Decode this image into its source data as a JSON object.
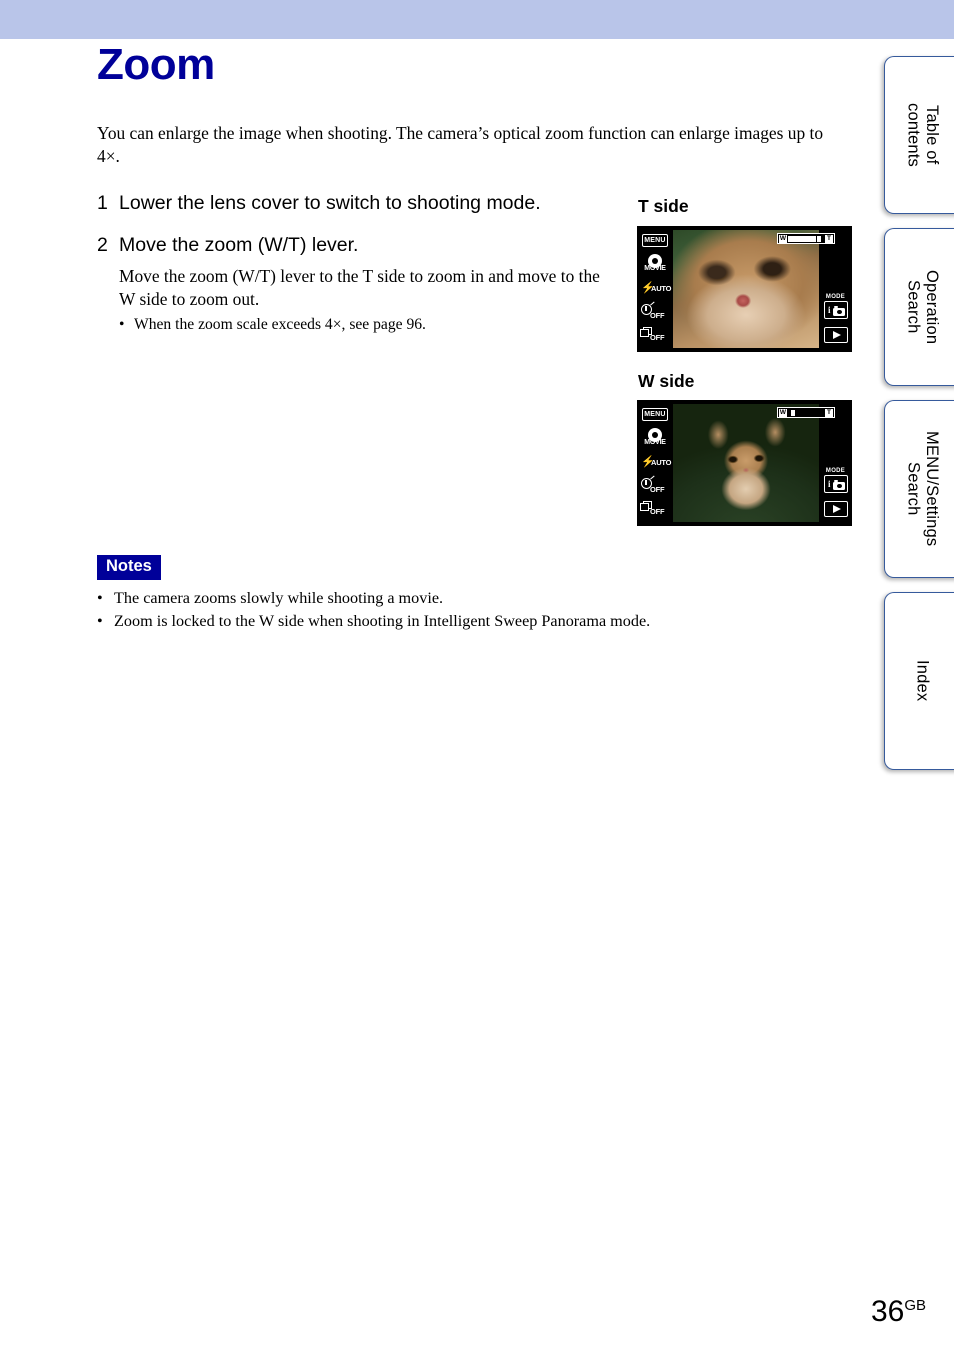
{
  "header": {
    "band_color": "#b9c5e9"
  },
  "page_title": "Zoom",
  "title_color": "#000099",
  "intro": "You can enlarge the image when shooting. The camera’s optical zoom function can enlarge images up to 4×.",
  "steps": [
    {
      "num": "1",
      "heading": "Lower the lens cover to switch to shooting mode.",
      "body": "",
      "bullets": []
    },
    {
      "num": "2",
      "heading": "Move the zoom (W/T) lever.",
      "body": "Move the zoom (W/T) lever to the T side to zoom in and move to the W side to zoom out.",
      "bullets": [
        "When the zoom scale exceeds 4×, see page 96."
      ]
    }
  ],
  "figures": [
    {
      "label": "T side",
      "icons": {
        "menu": "MENU",
        "movie": "MOVIE",
        "flash": "AUTO",
        "timer": "OFF",
        "burst": "OFF",
        "mode_label": "MODE",
        "mode_value": "i",
        "play": "▶"
      },
      "zoombar": {
        "w": "W",
        "t": "T",
        "fill_percent": 78,
        "marker_percent": 86
      }
    },
    {
      "label": "W side",
      "icons": {
        "menu": "MENU",
        "movie": "MOVIE",
        "flash": "AUTO",
        "timer": "OFF",
        "burst": "OFF",
        "mode_label": "MODE",
        "mode_value": "i",
        "play": "▶"
      },
      "zoombar": {
        "w": "W",
        "t": "T",
        "fill_percent": 0,
        "marker_percent": 13
      }
    }
  ],
  "notes": {
    "badge": "Notes",
    "badge_color": "#000099",
    "items": [
      "The camera zooms slowly while shooting a movie.",
      "Zoom is locked to the W side when shooting in Intelligent Sweep Panorama mode."
    ]
  },
  "tabs": [
    {
      "label": "Table of\ncontents"
    },
    {
      "label": "Operation\nSearch"
    },
    {
      "label": "MENU/Settings\nSearch"
    },
    {
      "label": "Index"
    }
  ],
  "tab_border_color": "#365a9c",
  "footer": {
    "page_number": "36",
    "region_code": "GB"
  },
  "bullet_char": "•"
}
